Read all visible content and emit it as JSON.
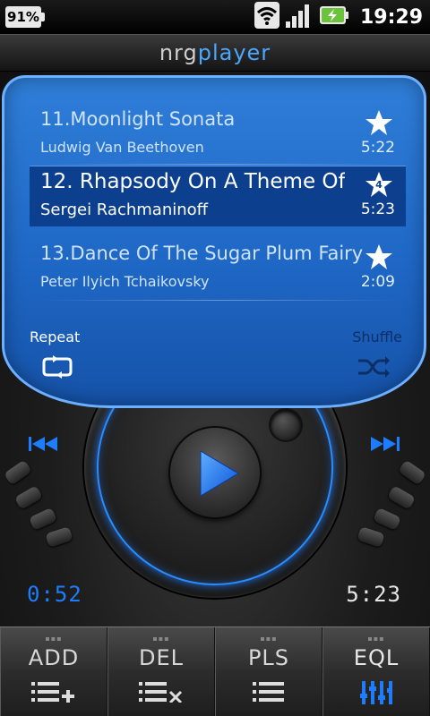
{
  "status_bar": {
    "battery_percent": "91%",
    "clock": "19:29",
    "icons": [
      "wifi-icon",
      "signal-icon",
      "battery-charging-icon"
    ]
  },
  "app": {
    "brand_part1": "nrg",
    "brand_part2": "player"
  },
  "playlist": {
    "tracks": [
      {
        "number": "11.",
        "title": "Moonlight Sonata",
        "artist": "Ludwig Van Beethoven",
        "duration": "5:22",
        "rating": ""
      },
      {
        "number": "12.",
        "title": "Rhapsody On A Theme Of",
        "artist": "Sergei Rachmaninoff",
        "duration": "5:23",
        "rating": "4"
      },
      {
        "number": "13.",
        "title": "Dance Of The Sugar Plum Fairy",
        "artist": "Peter Ilyich Tchaikovsky",
        "duration": "2:09",
        "rating": ""
      }
    ],
    "active_index": 1
  },
  "controls": {
    "repeat_label": "Repeat",
    "shuffle_label": "Shuffle",
    "elapsed": "0:52",
    "total": "5:23"
  },
  "toolbar": {
    "buttons": [
      {
        "label": "ADD",
        "icon": "list-add-icon"
      },
      {
        "label": "DEL",
        "icon": "list-delete-icon"
      },
      {
        "label": "PLS",
        "icon": "playlist-icon"
      },
      {
        "label": "EQL",
        "icon": "equalizer-icon"
      }
    ]
  },
  "colors": {
    "accent": "#2a8cff",
    "screen": "#1f68c6",
    "active_row": "#0d3f8f"
  }
}
